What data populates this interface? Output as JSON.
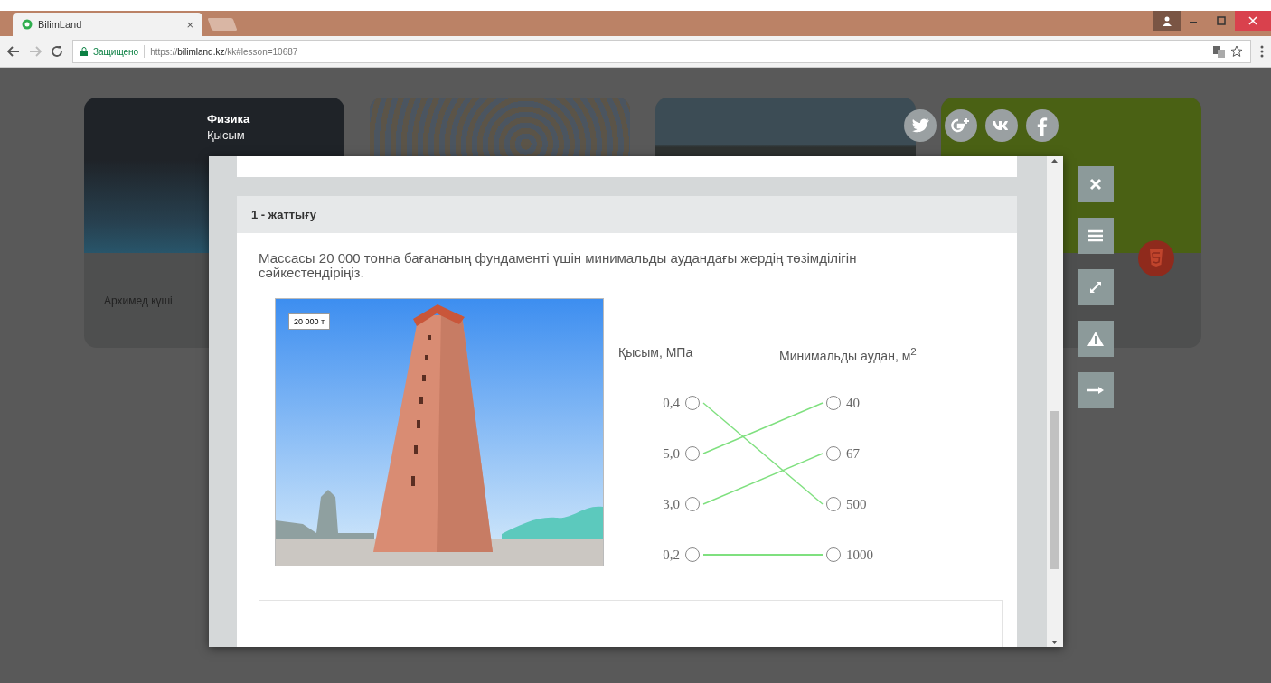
{
  "browser": {
    "tab": {
      "title": "BilimLand",
      "close": "×"
    },
    "secure_label": "Защищено",
    "url": "https://**bilimland.kz**/kk#lesson=10687"
  },
  "cards": [
    {
      "kind": "dark",
      "subject": "Физика",
      "topic": "Қысым",
      "caption": "Архимед күші"
    },
    {
      "kind": "map"
    },
    {
      "kind": "lake"
    },
    {
      "kind": "green"
    }
  ],
  "exercise": {
    "title": "1 - жаттығу",
    "question": "Массасы 20 000 тонна бағананың фундаменті үшін минимальды аудандағы жердің төзімділігін сәйкестендіріңіз.",
    "image_label": "20 000 т",
    "left_header": "Қысым, МПа",
    "right_header": "Минимальды аудан, м$^{2}$",
    "left": [
      {
        "text": "0,4",
        "linked_to": [
          false,
          false,
          true,
          false
        ]
      },
      {
        "text": "5,0",
        "linked_to": [
          true,
          false,
          false,
          false
        ]
      },
      {
        "text": "3,0",
        "linked_to": [
          false,
          true,
          false,
          false
        ]
      },
      {
        "text": "0,2",
        "linked_to": [
          false,
          false,
          false,
          true
        ]
      }
    ],
    "right": [
      {
        "text": "40"
      },
      {
        "text": "67"
      },
      {
        "text": "500"
      },
      {
        "text": "1000"
      }
    ]
  }
}
